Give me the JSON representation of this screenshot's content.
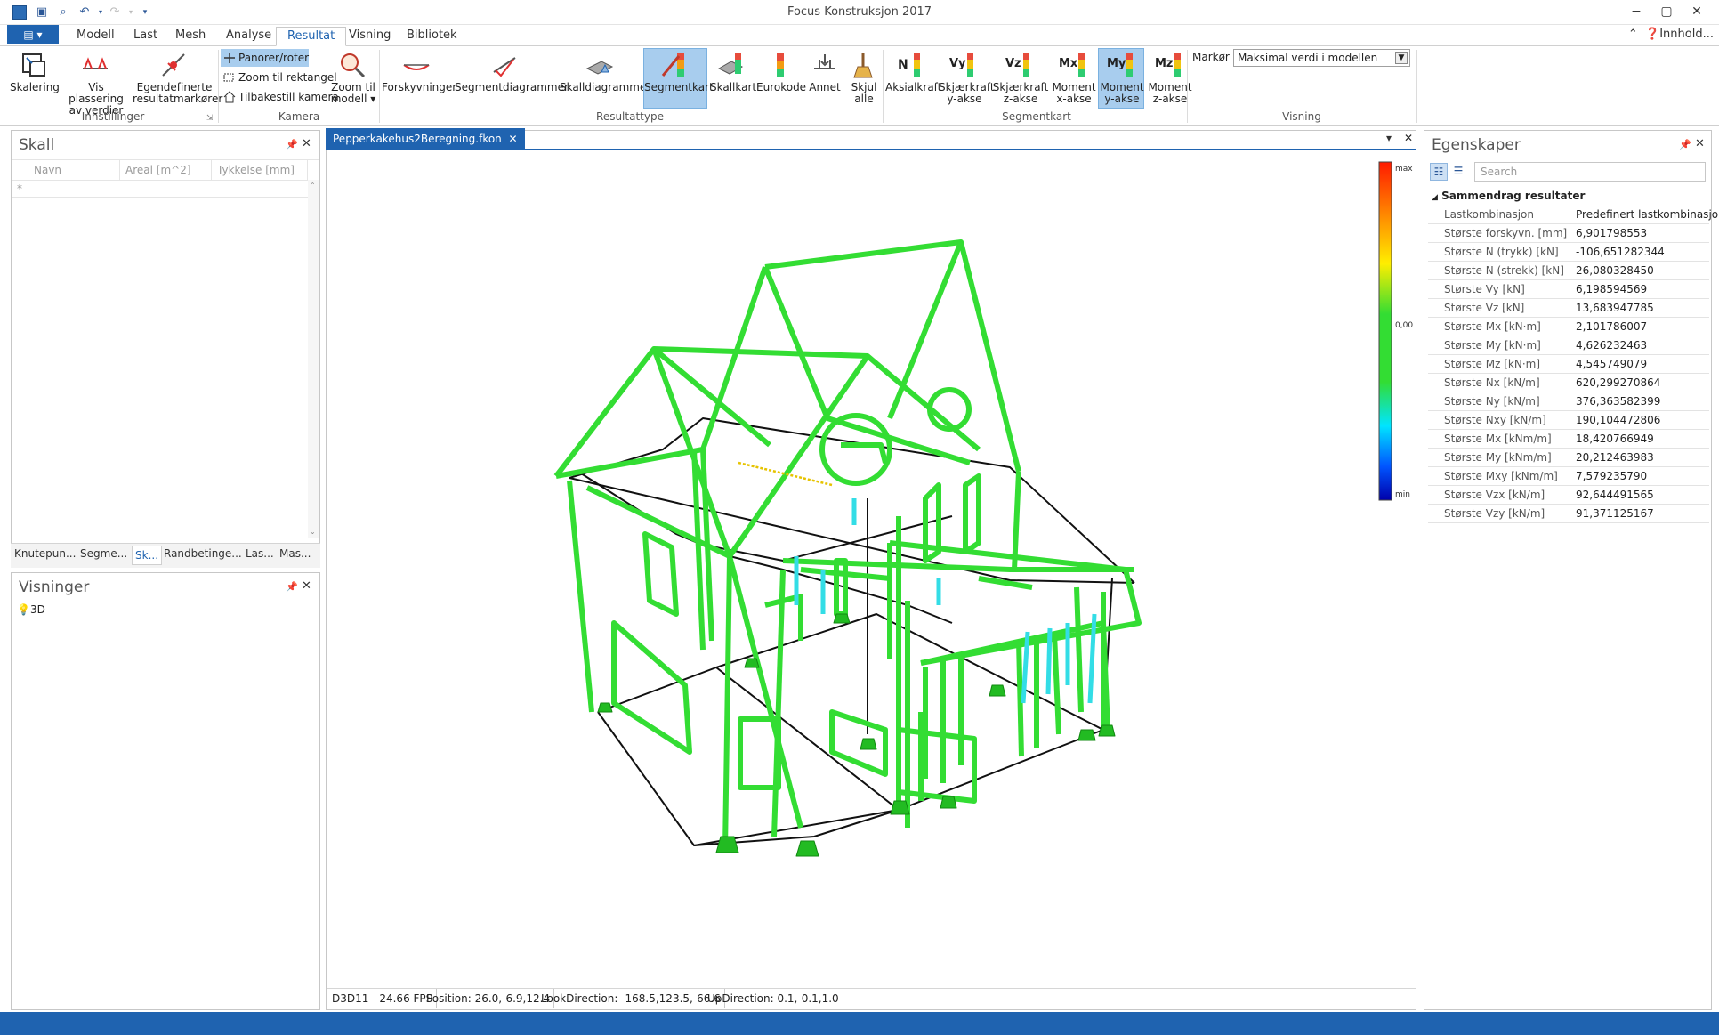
{
  "titlebar": {
    "title": "Focus Konstruksjon 2017",
    "app_icon": "KON"
  },
  "tabs": {
    "file": "▤ ▾",
    "items": [
      "Modell",
      "Last",
      "Mesh",
      "Analyse",
      "Resultat",
      "Visning",
      "Bibliotek"
    ],
    "active": "Resultat",
    "help": "Innhold..."
  },
  "ribbon": {
    "innstillinger": {
      "group": "Innstillinger",
      "scaling": "Skalering",
      "show_values": "Vis plassering av verdier",
      "custom_markers": "Egendefinerte resultatmarkører"
    },
    "kamera": {
      "group": "Kamera",
      "pan": "Panorer/roter",
      "zoom_rect": "Zoom til rektangel",
      "reset": "Tilbakestill kamera",
      "zoom_model": "Zoom til modell ▾"
    },
    "resultattype": {
      "group": "Resultattype",
      "forskyvninger": "Forskyvninger",
      "segmentdiagrammer": "Segmentdiagrammer",
      "skalldiagrammer": "Skalldiagrammer",
      "segmentkart": "Segmentkart",
      "skallkart": "Skallkart",
      "eurokode": "Eurokode",
      "annet": "Annet",
      "skjul": "Skjul alle"
    },
    "segmentkart": {
      "group": "Segmentkart",
      "aksialkraft": "Aksialkraft",
      "skjaerkraft_y": "Skjærkraft y-akse",
      "skjaerkraft_z": "Skjærkraft z-akse",
      "moment_x": "Moment x-akse",
      "moment_y": "Moment y-akse",
      "moment_z": "Moment z-akse"
    },
    "visning": {
      "group": "Visning",
      "marker_label": "Markør",
      "marker_value": "Maksimal verdi i modellen"
    }
  },
  "skall": {
    "title": "Skall",
    "columns": [
      "Navn",
      "Areal [m^2]",
      "Tykkelse [mm]"
    ],
    "new_row_marker": "*"
  },
  "bottom_tabs": [
    "Knutepun...",
    "Segme...",
    "Sk...",
    "Randbetinge...",
    "Las...",
    "Mas..."
  ],
  "visninger": {
    "title": "Visninger",
    "items": [
      {
        "label": "3D"
      }
    ]
  },
  "document": {
    "tab": "Pepperkakehus2Beregning.fkon"
  },
  "legend": {
    "max": "max",
    "zero": "0,00",
    "min": "min"
  },
  "status": {
    "fps": "D3D11 - 24.66 FPS",
    "position": "Position: 26.0,-6.9,12.4",
    "look": "LookDirection: -168.5,123.5,-66.6",
    "up": "UpDirection: 0.1,-0.1,1.0"
  },
  "properties": {
    "title": "Egenskaper",
    "search_placeholder": "Search",
    "category": "Sammendrag resultater",
    "rows": [
      {
        "key": "Lastkombinasjon",
        "value": "Predefinert lastkombinasjon"
      },
      {
        "key": "Største forskyvn. [mm]",
        "value": "6,901798553"
      },
      {
        "key": "Største N (trykk) [kN]",
        "value": "-106,651282344"
      },
      {
        "key": "Største N (strekk) [kN]",
        "value": "26,080328450"
      },
      {
        "key": "Største Vy [kN]",
        "value": "6,198594569"
      },
      {
        "key": "Største Vz [kN]",
        "value": "13,683947785"
      },
      {
        "key": "Største Mx [kN·m]",
        "value": "2,101786007"
      },
      {
        "key": "Største My [kN·m]",
        "value": "4,626232463"
      },
      {
        "key": "Største Mz [kN·m]",
        "value": "4,545749079"
      },
      {
        "key": "Største Nx [kN/m]",
        "value": "620,299270864"
      },
      {
        "key": "Største Ny [kN/m]",
        "value": "376,363582399"
      },
      {
        "key": "Største Nxy [kN/m]",
        "value": "190,104472806"
      },
      {
        "key": "Største Mx [kNm/m]",
        "value": "18,420766949"
      },
      {
        "key": "Største My [kNm/m]",
        "value": "20,212463983"
      },
      {
        "key": "Største Mxy [kNm/m]",
        "value": "7,579235790"
      },
      {
        "key": "Største Vzx [kN/m]",
        "value": "92,644491565"
      },
      {
        "key": "Største Vzy [kN/m]",
        "value": "91,371125167"
      }
    ]
  },
  "colors": {
    "accent": "#1f63b0",
    "member": "#33dd33",
    "selected": "#a8cdee"
  }
}
